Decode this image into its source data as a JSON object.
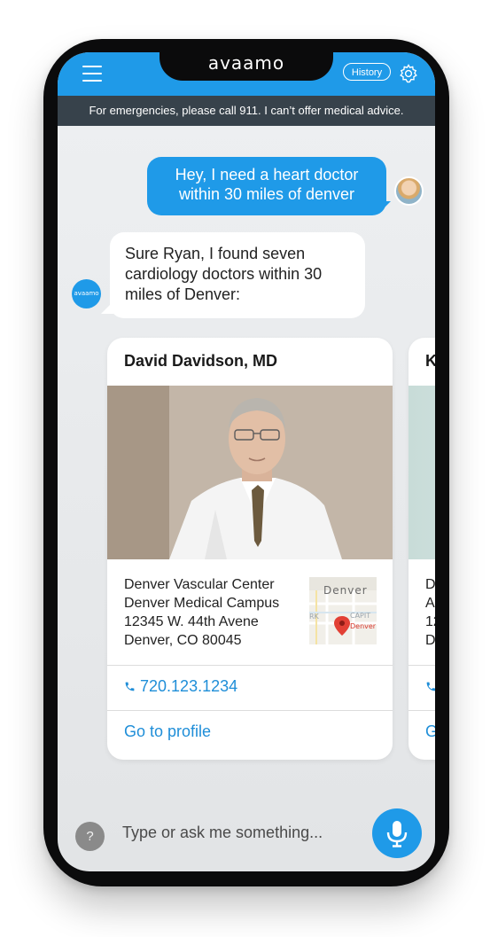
{
  "app": {
    "logo_text": "avaamo"
  },
  "header": {
    "history_label": "History",
    "menu_icon": "hamburger-icon",
    "settings_icon": "gear-icon"
  },
  "banner": {
    "text": "For emergencies, please call 911. I can’t offer medical advice."
  },
  "conversation": {
    "user_message": [
      "Hey, I need a heart doctor",
      "within 30 miles of denver"
    ],
    "bot_message": [
      "Sure Ryan, I found seven",
      "cardiology doctors within 30",
      "miles of Denver:"
    ],
    "bot_avatar_text": "avaamo"
  },
  "cards": [
    {
      "name": "David Davidson, MD",
      "address": [
        "Denver Vascular Center",
        "Denver Medical Campus",
        "12345 W. 44th Avene",
        "Denver, CO 80045"
      ],
      "map": {
        "label_top": "Denver",
        "label_capit": "CAPIT",
        "label_rk": "RK",
        "label_pin": "Denver"
      },
      "phone": "720.123.1234",
      "profile_link": "Go to profile"
    },
    {
      "name": "K",
      "address": [
        "D",
        "A",
        "12",
        "D"
      ],
      "phone": "",
      "profile_link": "G"
    }
  ],
  "composer": {
    "help_label": "?",
    "placeholder": "Type or ask me something...",
    "mic_icon": "microphone-icon"
  },
  "colors": {
    "brand_blue": "#1f9ae8",
    "link_blue": "#1f8ed8",
    "banner_bg": "#37424b",
    "help_gray": "#8a8a8a"
  }
}
